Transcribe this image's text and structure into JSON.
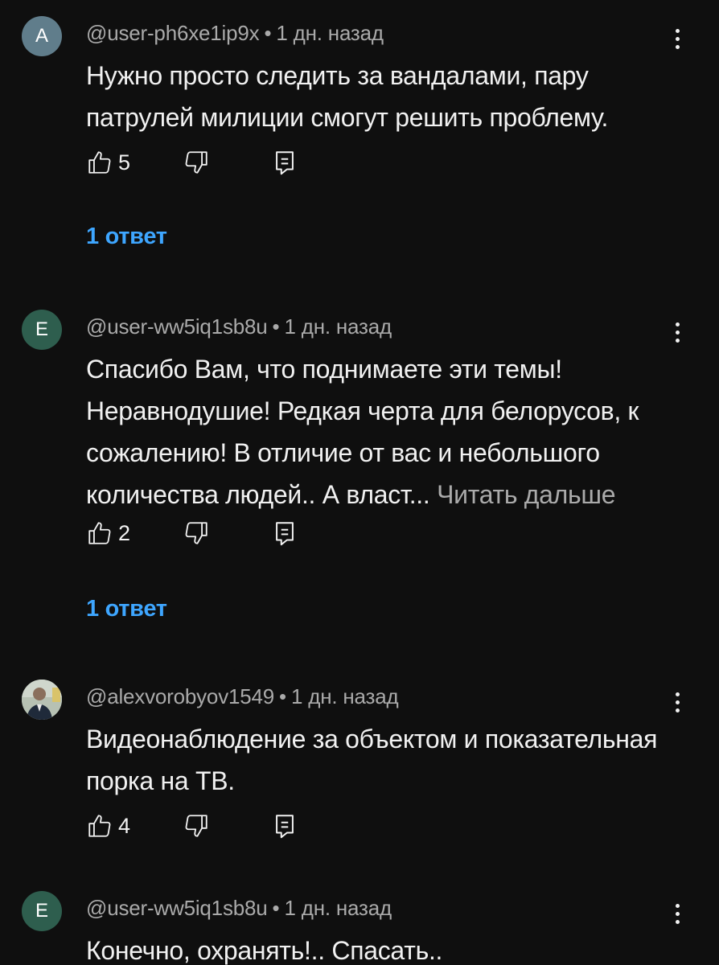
{
  "comments": [
    {
      "avatar_letter": "A",
      "avatar_color": "#607d8b",
      "author": "@user-ph6xe1ip9x",
      "time": "1 дн. назад",
      "text": "Нужно просто следить за вандалами, пару патрулей милиции смогут решить проблему.",
      "read_more": "",
      "likes": "5",
      "replies": "1 ответ"
    },
    {
      "avatar_letter": "E",
      "avatar_color": "#2e5e4e",
      "author": "@user-ww5iq1sb8u",
      "time": "1 дн. назад",
      "text": "Спасибо Вам, что поднимаете эти темы! Неравнодушие! Редкая черта для белорусов, к сожалению! В отличие от вас и небольшого количества людей.. А власт...",
      "read_more": "Читать дальше",
      "likes": "2",
      "replies": "1 ответ"
    },
    {
      "avatar_letter": "",
      "avatar_color": "#9aa69a",
      "author": "@alexvorobyov1549",
      "time": "1 дн. назад",
      "text": "Видеонаблюдение за объектом и показательная порка на ТВ.",
      "read_more": "",
      "likes": "4",
      "replies": ""
    },
    {
      "avatar_letter": "E",
      "avatar_color": "#2e5e4e",
      "author": "@user-ww5iq1sb8u",
      "time": "1 дн. назад",
      "text": "Конечно, охранять!.. Спасать..",
      "read_more": "",
      "likes": "",
      "replies": ""
    }
  ],
  "separator": "•",
  "icons": {
    "like": "thumbs-up-icon",
    "dislike": "thumbs-down-icon",
    "reply": "reply-comment-icon",
    "menu": "more-vertical-icon"
  },
  "colors": {
    "background": "#0f0f0f",
    "text": "#f1f1f1",
    "secondary": "#aaaaaa",
    "link": "#3ea6ff"
  }
}
